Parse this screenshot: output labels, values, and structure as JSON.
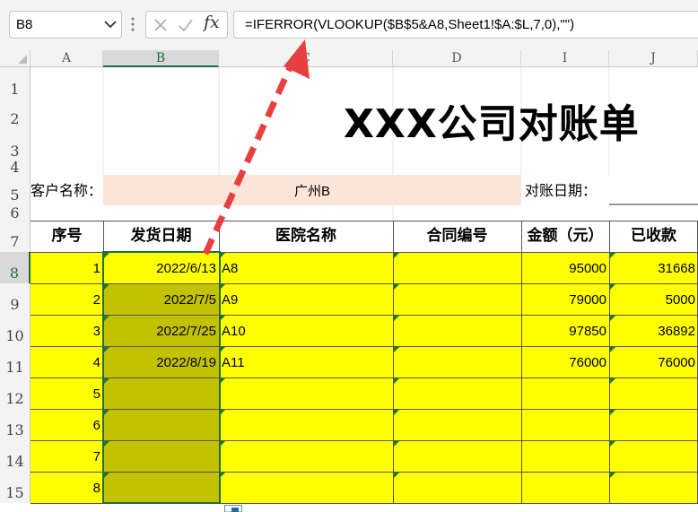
{
  "formula_bar": {
    "name_box": "B8",
    "formula": "=IFERROR(VLOOKUP($B$5&A8,Sheet1!$A:$L,7,0),\"\")"
  },
  "icons": {
    "dropdown": "chevron-down-icon",
    "cancel": "close-icon",
    "enter": "check-icon",
    "function": "fx-icon"
  },
  "columns": [
    "A",
    "B",
    "C",
    "D",
    "I",
    "J"
  ],
  "rows": [
    "1",
    "2",
    "3",
    "4",
    "5",
    "6",
    "7",
    "8",
    "9",
    "10",
    "11",
    "12",
    "13",
    "14",
    "15"
  ],
  "sheet": {
    "title": "XXX公司对账单",
    "customer_label": "客户名称：",
    "customer_value": "广州B",
    "date_label": "对账日期：",
    "headers": [
      "序号",
      "发货日期",
      "医院名称",
      "合同编号",
      "金额（元）",
      "已收款"
    ],
    "data_rows": [
      {
        "seq": "1",
        "date": "2022/6/13",
        "hospital": "A8",
        "contract": "",
        "amount": "95000",
        "received": "31668"
      },
      {
        "seq": "2",
        "date": "2022/7/5",
        "hospital": "A9",
        "contract": "",
        "amount": "79000",
        "received": "5000"
      },
      {
        "seq": "3",
        "date": "2022/7/25",
        "hospital": "A10",
        "contract": "",
        "amount": "97850",
        "received": "36892"
      },
      {
        "seq": "4",
        "date": "2022/8/19",
        "hospital": "A11",
        "contract": "",
        "amount": "76000",
        "received": "76000"
      },
      {
        "seq": "5",
        "date": "",
        "hospital": "",
        "contract": "",
        "amount": "",
        "received": ""
      },
      {
        "seq": "6",
        "date": "",
        "hospital": "",
        "contract": "",
        "amount": "",
        "received": ""
      },
      {
        "seq": "7",
        "date": "",
        "hospital": "",
        "contract": "",
        "amount": "",
        "received": ""
      },
      {
        "seq": "8",
        "date": "",
        "hospital": "",
        "contract": "",
        "amount": "",
        "received": ""
      }
    ]
  },
  "colors": {
    "yellow_fill": "#ffff00",
    "selected_fill": "#c3c200",
    "customer_fill": "#fbe5d6",
    "arrow": "#e84040",
    "selection_border": "#1e6e3e"
  }
}
